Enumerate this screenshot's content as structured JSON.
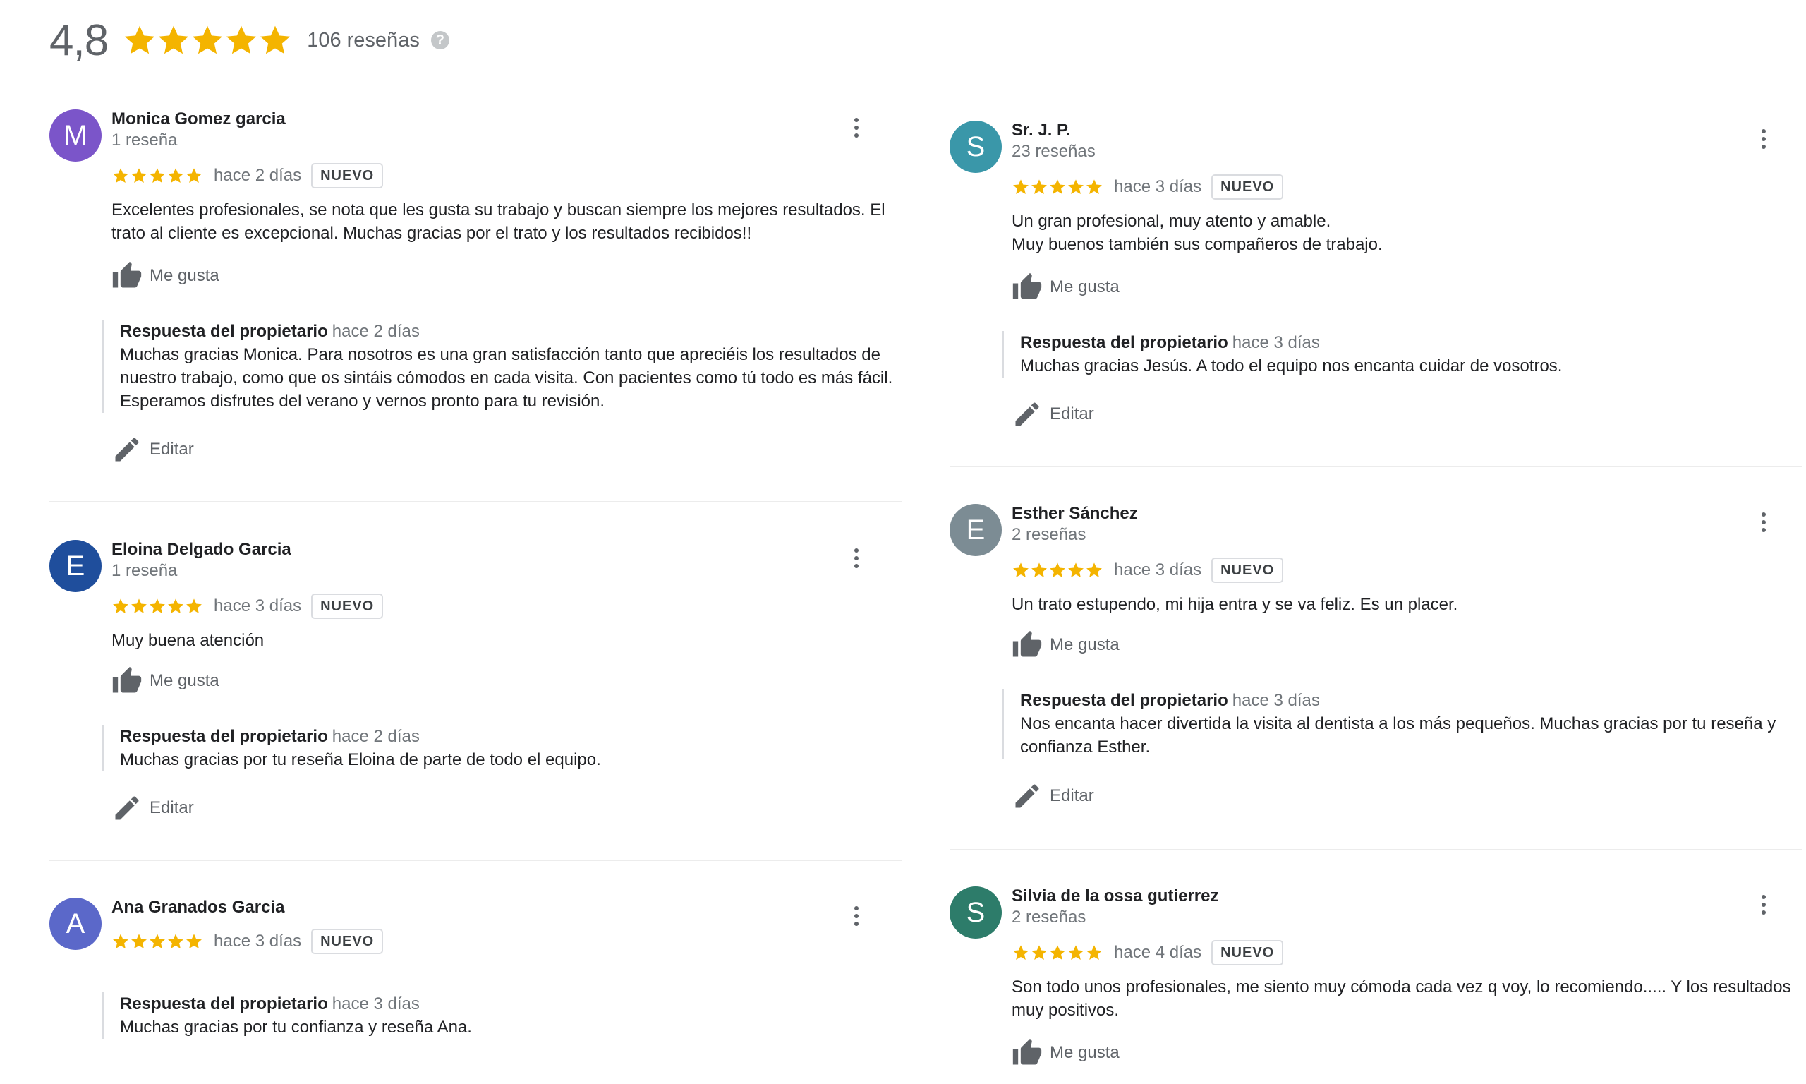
{
  "summary": {
    "rating": "4,8",
    "total": "106 reseñas",
    "help_icon": "?"
  },
  "colors": {
    "star": "#f4b400",
    "avatar_purple": "#7b55c9",
    "avatar_navy": "#1f4e9c",
    "avatar_indigo": "#5b68c9",
    "avatar_teal": "#3a97a9",
    "avatar_gray": "#7c8c94",
    "avatar_green": "#2d7c6a"
  },
  "labels": {
    "like": "Me gusta",
    "edit": "Editar",
    "reply_title": "Respuesta del propietario",
    "new_badge": "NUEVO"
  },
  "reviews": [
    {
      "initial": "M",
      "name": "Monica Gomez garcia",
      "count": "1 reseña",
      "rating": 5,
      "date": "hace 2 días",
      "text": "Excelentes profesionales, se nota que les gusta su trabajo y buscan siempre los mejores resultados. El trato al cliente es excepcional. Muchas gracias por el trato y los resultados recibidos!!",
      "reply_date": "hace 2 días",
      "reply_text": "Muchas gracias Monica. Para nosotros es una gran satisfacción tanto que apreciéis los resultados de nuestro trabajo, como que os sintáis cómodos en cada visita. Con pacientes como tú todo es más fácil. Esperamos disfrutes del verano y vernos pronto para tu revisión."
    },
    {
      "initial": "E",
      "name": "Eloina Delgado Garcia",
      "count": "1 reseña",
      "rating": 5,
      "date": "hace 3 días",
      "text": "Muy buena atención",
      "reply_date": "hace 2 días",
      "reply_text": "Muchas gracias por tu reseña Eloina de parte de todo el equipo."
    },
    {
      "initial": "A",
      "name": "Ana Granados Garcia",
      "rating": 5,
      "date": "hace 3 días",
      "reply_date": "hace 3 días",
      "reply_text": "Muchas gracias por tu confianza y reseña Ana."
    },
    {
      "initial": "S",
      "name": "Sr. J. P.",
      "count": "23 reseñas",
      "rating": 5,
      "date": "hace 3 días",
      "text_line1": "Un gran profesional, muy atento y amable.",
      "text_line2": "Muy buenos también sus compañeros de trabajo.",
      "reply_date": "hace 3 días",
      "reply_text": "Muchas gracias Jesús. A todo el equipo nos encanta cuidar de vosotros."
    },
    {
      "initial": "E",
      "name": "Esther Sánchez",
      "count": "2 reseñas",
      "rating": 5,
      "date": "hace 3 días",
      "text": "Un trato estupendo, mi hija entra y se va feliz. Es un placer.",
      "reply_date": "hace 3 días",
      "reply_text": "Nos encanta hacer divertida la visita al dentista a los más pequeños. Muchas gracias por tu reseña y confianza Esther."
    },
    {
      "initial": "S",
      "name": "Silvia de la ossa gutierrez",
      "count": "2 reseñas",
      "rating": 5,
      "date": "hace 4 días",
      "text": "Son todo unos profesionales, me siento muy cómoda cada vez q voy, lo recomiendo..... Y los resultados muy positivos."
    }
  ]
}
